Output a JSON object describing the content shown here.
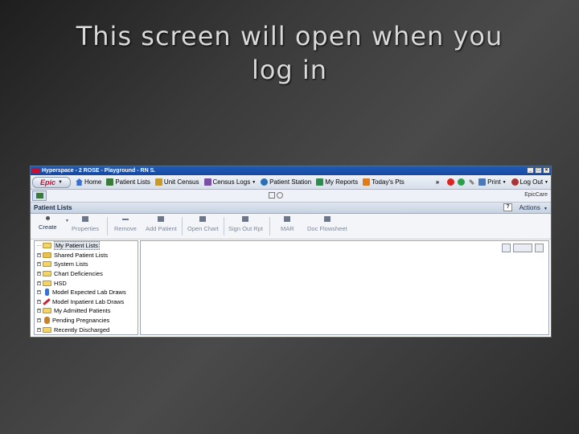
{
  "slide": {
    "title_line1": "This screen will open when you",
    "title_line2": "log in"
  },
  "window": {
    "title": "Hyperspace - 2 ROSE - Playground - RN S.",
    "buttons": [
      "_",
      "□",
      "×"
    ]
  },
  "menubar": {
    "epic_label": "Epic",
    "items": [
      {
        "label": "Home",
        "icon": "home-icon"
      },
      {
        "label": "Patient Lists",
        "icon": "patient-lists-icon"
      },
      {
        "label": "Unit Census",
        "icon": "unit-census-icon"
      },
      {
        "label": "Census Logs",
        "icon": "census-logs-icon"
      },
      {
        "label": "Patient Station",
        "icon": "patient-station-icon"
      },
      {
        "label": "My Reports",
        "icon": "reports-icon"
      },
      {
        "label": "Today's Pts",
        "icon": "todays-patients-icon"
      }
    ],
    "overflow": "»",
    "print_label": "Print",
    "logout_label": "Log Out"
  },
  "tabbar": {
    "right_label": "EpicCare"
  },
  "activity": {
    "title": "Patient Lists",
    "help_label": "?",
    "actions_label": "Actions"
  },
  "toolbar": {
    "create": "Create",
    "properties": "Properties",
    "remove": "Remove",
    "add_patient": "Add Patient",
    "open_chart": "Open Chart",
    "sign_out_rpt": "Sign Out Rpt",
    "mar": "MAR",
    "doc_flowsheet": "Doc Flowsheet"
  },
  "tree": [
    {
      "label": "My Patient Lists",
      "icon": "folder-open-icon",
      "expandable": false,
      "selected": true
    },
    {
      "label": "Shared Patient Lists",
      "icon": "shared-folder-icon",
      "expandable": true
    },
    {
      "label": "System Lists",
      "icon": "folder-icon",
      "expandable": true
    },
    {
      "label": "Chart Deficiencies",
      "icon": "folder-icon",
      "expandable": true
    },
    {
      "label": "HSD",
      "icon": "folder-open-icon",
      "expandable": true
    },
    {
      "label": "Model Expected Lab Draws",
      "icon": "person-icon",
      "expandable": true
    },
    {
      "label": "Model Inpatient Lab Draws",
      "icon": "syringe-icon",
      "expandable": true
    },
    {
      "label": "My Admitted Patients",
      "icon": "folder-icon",
      "expandable": true
    },
    {
      "label": "Pending Pregnancies",
      "icon": "pregnancy-icon",
      "expandable": true
    },
    {
      "label": "Recently Discharged",
      "icon": "folder-open-icon",
      "expandable": true
    }
  ]
}
